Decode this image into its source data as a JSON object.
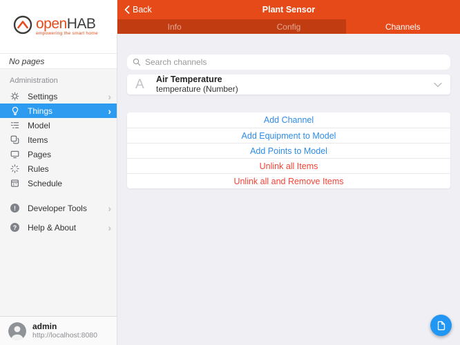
{
  "sidebar": {
    "logo": {
      "brand_open": "open",
      "brand_hab": "HAB",
      "tagline": "empowering the smart home",
      "icon": "openhab-house-circle-icon"
    },
    "no_pages_label": "No pages",
    "section_label": "Administration",
    "items": [
      {
        "label": "Settings",
        "icon": "gear-icon",
        "chevron": "›",
        "active": false
      },
      {
        "label": "Things",
        "icon": "lightbulb-icon",
        "chevron": "›",
        "active": true
      },
      {
        "label": "Model",
        "icon": "tree-list-icon",
        "active": false
      },
      {
        "label": "Items",
        "icon": "overlapping-squares-icon",
        "active": false
      },
      {
        "label": "Pages",
        "icon": "display-icon",
        "active": false
      },
      {
        "label": "Rules",
        "icon": "sparkle-icon",
        "active": false
      },
      {
        "label": "Schedule",
        "icon": "calendar-icon",
        "active": false
      }
    ],
    "secondary_items": [
      {
        "label": "Developer Tools",
        "icon": "exclamation-circle-icon",
        "badge_glyph": "!",
        "chevron": "›"
      },
      {
        "label": "Help & About",
        "icon": "question-circle-icon",
        "badge_glyph": "?",
        "chevron": "›"
      }
    ],
    "user": {
      "name": "admin",
      "url": "http://localhost:8080",
      "icon": "avatar"
    }
  },
  "navbar": {
    "back_label": "Back",
    "title": "Plant Sensor"
  },
  "tabs": [
    {
      "label": "Info",
      "active": false
    },
    {
      "label": "Config",
      "active": false
    },
    {
      "label": "Channels",
      "active": true
    }
  ],
  "main": {
    "search": {
      "placeholder": "Search channels",
      "icon": "search-icon"
    },
    "channel": {
      "letter": "A",
      "title": "Air Temperature",
      "subtitle": "temperature (Number)",
      "icon": "chevron-down-icon"
    },
    "actions": [
      {
        "label": "Add Channel",
        "color": "blue"
      },
      {
        "label": "Add Equipment to Model",
        "color": "blue"
      },
      {
        "label": "Add Points to Model",
        "color": "blue"
      },
      {
        "label": "Unlink all Items",
        "color": "red"
      },
      {
        "label": "Unlink all and Remove Items",
        "color": "red"
      }
    ],
    "fab_icon": "document-icon"
  },
  "colors": {
    "brand_orange": "#e64a19",
    "tabbar_inactive_bg": "#c13c10",
    "sidebar_active_blue": "#2d9bf0",
    "link_blue": "#2e8ce6",
    "danger_red": "#f44336",
    "fab_blue": "#2196f3",
    "page_bg": "#efeff4"
  }
}
